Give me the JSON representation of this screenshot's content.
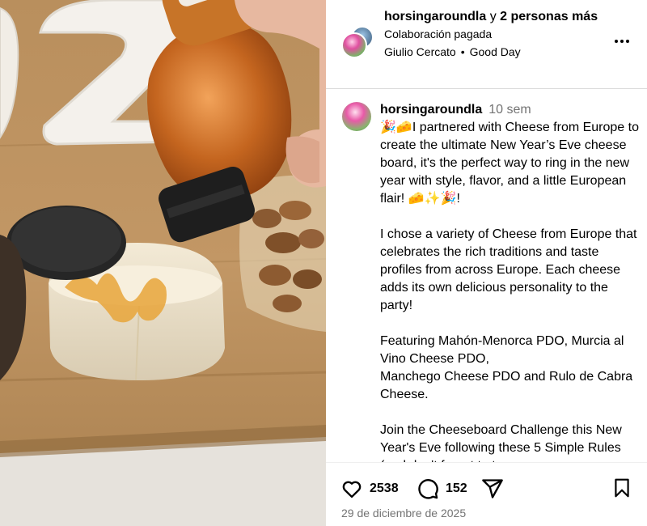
{
  "post": {
    "header": {
      "username": "horsingaroundla",
      "conjunction": "y",
      "others": "2 personas más",
      "paid_label": "Colaboración pagada",
      "audio_artist": "Giulio Cercato",
      "audio_separator": "•",
      "audio_title": "Good Day",
      "more_icon": "more-horizontal-icon"
    },
    "caption": {
      "username": "horsingaroundla",
      "time": "10 sem",
      "paragraphs": [
        "🎉🧀I partnered with Cheese from Europe to create the ultimate New Year’s Eve cheese board, it's the perfect way to ring in the new year with style, flavor, and a little European flair! 🧀✨🎉!",
        "I chose a variety of Cheese from Europe that celebrates the rich traditions and taste profiles from across Europe. Each cheese adds its own delicious personality to the party!",
        "Featuring Mahón-Menorca PDO, Murcia al Vino Cheese PDO,\nManchego Cheese PDO and Rulo de Cabra Cheese.",
        "Join the Cheeseboard Challenge this New Year's Eve following these 5 Simple Rules (and don't forget to tag"
      ]
    },
    "actions": {
      "likes": "2538",
      "comments": "152",
      "like_icon": "heart-icon",
      "comment_icon": "comment-icon",
      "share_icon": "paper-plane-icon",
      "save_icon": "bookmark-icon"
    },
    "date": "29 de diciembre de 2025"
  }
}
